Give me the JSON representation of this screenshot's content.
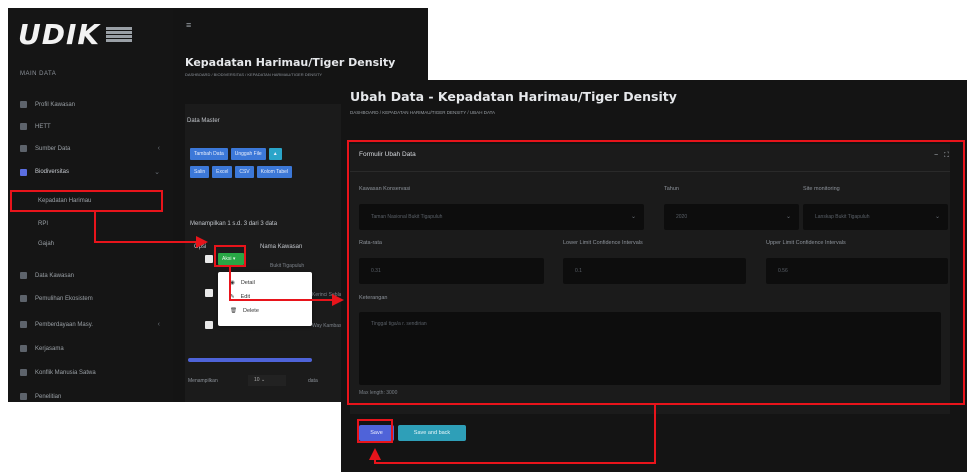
{
  "logo": {
    "text": "UDIK"
  },
  "sidebar": {
    "header": "MAIN DATA",
    "items": [
      {
        "label": "Profil Kawasan"
      },
      {
        "label": "HETT"
      },
      {
        "label": "Sumber Data"
      },
      {
        "label": "Biodiversitas"
      },
      {
        "label": "Data Kawasan"
      },
      {
        "label": "Pemulihan Ekosistem"
      },
      {
        "label": "Pemberdayaan Masy."
      },
      {
        "label": "Kerjasama"
      },
      {
        "label": "Konflik Manusia Satwa"
      },
      {
        "label": "Penelitian"
      }
    ],
    "sub_items": [
      "Kepadatan Harimau",
      "RPI",
      "Gajah"
    ]
  },
  "list_page": {
    "title": "Kepadatan Harimau/Tiger Density",
    "breadcrumb": "DASHBOARD  /  BIODIVERSITAS  /  KEPADATAN HARIMAU/TIGER DENSITY",
    "card_title": "Data Master",
    "buttons_row1": [
      "Tambah Data",
      "Unggah File"
    ],
    "buttons_row2": [
      "Salin",
      "Excel",
      "CSV",
      "Kolom Tabel"
    ],
    "info": "Menampilkan 1 s.d. 3 dari 3 data",
    "columns": [
      "Opsi",
      "Nama Kawasan"
    ],
    "row_values": [
      "Bukit Tigapuluh",
      "Kerinci Seblat",
      "Way Kambas"
    ],
    "action_label": "Aksi",
    "dropdown": [
      {
        "icon": "eye-icon",
        "label": "Detail"
      },
      {
        "icon": "pencil-icon",
        "label": "Edit"
      },
      {
        "icon": "trash-icon",
        "label": "Delete"
      }
    ],
    "footer_label": "Menampilkan",
    "footer_select": "10",
    "footer_suffix": "data"
  },
  "edit_page": {
    "title": "Ubah Data - Kepadatan Harimau/Tiger Density",
    "breadcrumb": "DASHBOARD  /  KEPADATAN HARIMAU/TIGER DENSITY  /  UBAH DATA",
    "form_title": "Formulir Ubah Data",
    "tools": "− ⛶",
    "fields": {
      "kawasan": {
        "label": "Kawasan Konservasi",
        "value": "Taman Nasional Bukit Tigapuluh"
      },
      "tahun": {
        "label": "Tahun",
        "value": "2020"
      },
      "site": {
        "label": "Site monitoring",
        "value": "Lanskap Bukit Tigapuluh"
      },
      "rata": {
        "label": "Rata-rata",
        "value": "0.31"
      },
      "lower": {
        "label": "Lower Limit Confidence Intervals",
        "value": "0.1"
      },
      "upper": {
        "label": "Upper Limit Confidence Intervals",
        "value": "0.56"
      },
      "keterangan": {
        "label": "Keterangan",
        "placeholder": "Tinggal tiga/a r. sendirian"
      },
      "help": "Max length: 3000"
    },
    "save_label": "Save",
    "save_back_label": "Save and back"
  },
  "annotation_color": "#e8141b"
}
